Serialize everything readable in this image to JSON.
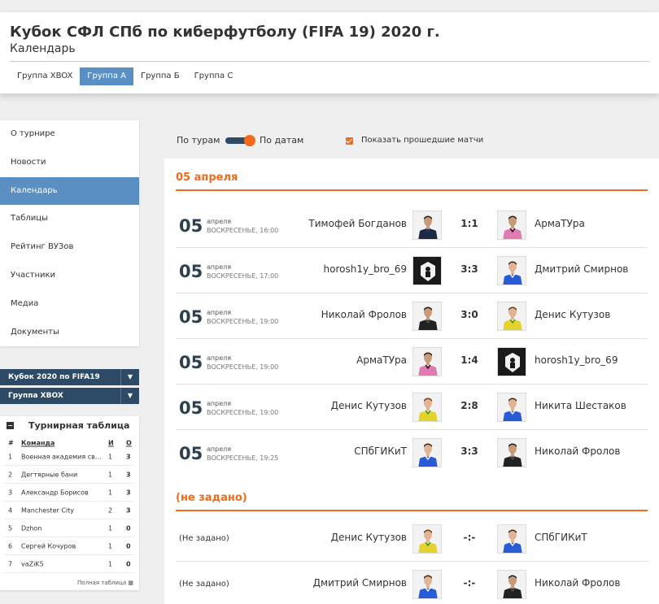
{
  "header": {
    "title": "Кубок СФЛ СПб по киберфутболу (FIFA 19) 2020 г.",
    "subtitle": "Календарь",
    "tabs": [
      {
        "label": "Группа XBOX",
        "active": false
      },
      {
        "label": "Группа А",
        "active": true
      },
      {
        "label": "Группа Б",
        "active": false
      },
      {
        "label": "Группа С",
        "active": false
      }
    ]
  },
  "menu": {
    "items": [
      {
        "label": "О турнире",
        "active": false
      },
      {
        "label": "Новости",
        "active": false
      },
      {
        "label": "Календарь",
        "active": true
      },
      {
        "label": "Таблицы",
        "active": false
      },
      {
        "label": "Рейтинг ВУЗов",
        "active": false
      },
      {
        "label": "Участники",
        "active": false
      },
      {
        "label": "Медиа",
        "active": false
      },
      {
        "label": "Документы",
        "active": false
      }
    ]
  },
  "selects": {
    "tournament": "Кубок 2020 по FIFA19",
    "group": "Группа XBOX",
    "arrow_icon": "caret-down-icon"
  },
  "standings": {
    "title": "Турнирная таблица",
    "headers": {
      "num": "#",
      "team": "Команда",
      "played": "И",
      "points": "О"
    },
    "rows": [
      {
        "num": "1",
        "team": "Военная академия связи",
        "played": "1",
        "points": "3"
      },
      {
        "num": "2",
        "team": "Дегтярные бани",
        "played": "1",
        "points": "3"
      },
      {
        "num": "3",
        "team": "Александр Борисов",
        "played": "1",
        "points": "3"
      },
      {
        "num": "4",
        "team": "Manchester City",
        "played": "2",
        "points": "3"
      },
      {
        "num": "5",
        "team": "Dzhon",
        "played": "1",
        "points": "0"
      },
      {
        "num": "6",
        "team": "Сергей Кочуров",
        "played": "1",
        "points": "0"
      },
      {
        "num": "7",
        "team": "vaZiK5",
        "played": "1",
        "points": "0"
      }
    ],
    "full_table_label": "Полная таблица"
  },
  "controls": {
    "by_rounds": "По турам",
    "by_dates": "По датам",
    "show_past": "Показать прошедшие матчи",
    "show_past_checked": true
  },
  "sections": [
    {
      "date": "05 апреля",
      "matches": [
        {
          "day": "05",
          "month": "апреля",
          "time": "ВОСКРЕСЕНЬЕ, 16:00",
          "home": "Тимофей Богданов",
          "home_kit": "dark",
          "score": "1:1",
          "away": "АрмаТУра",
          "away_kit": "pink"
        },
        {
          "day": "05",
          "month": "апреля",
          "time": "ВОСКРЕСЕНЬЕ, 17:00",
          "home": "horosh1y_bro_69",
          "home_kit": "logo",
          "score": "3:3",
          "away": "Дмитрий Смирнов",
          "away_kit": "blue"
        },
        {
          "day": "05",
          "month": "апреля",
          "time": "ВОСКРЕСЕНЬЕ, 19:00",
          "home": "Николай Фролов",
          "home_kit": "black",
          "score": "3:0",
          "away": "Денис Кутузов",
          "away_kit": "yellow"
        },
        {
          "day": "05",
          "month": "апреля",
          "time": "ВОСКРЕСЕНЬЕ, 19:00",
          "home": "АрмаТУра",
          "home_kit": "pink",
          "score": "1:4",
          "away": "horosh1y_bro_69",
          "away_kit": "logo"
        },
        {
          "day": "05",
          "month": "апреля",
          "time": "ВОСКРЕСЕНЬЕ, 19:00",
          "home": "Денис Кутузов",
          "home_kit": "yellow",
          "score": "2:8",
          "away": "Никита Шестаков",
          "away_kit": "blue"
        },
        {
          "day": "05",
          "month": "апреля",
          "time": "ВОСКРЕСЕНЬЕ, 19:25",
          "home": "СПбГИКиТ",
          "home_kit": "blue",
          "score": "3:3",
          "away": "Николай Фролов",
          "away_kit": "black"
        }
      ]
    },
    {
      "date": "(не задано)",
      "matches": [
        {
          "unset": "(Не задано)",
          "home": "Денис Кутузов",
          "home_kit": "yellow",
          "score": "-:-",
          "away": "СПбГИКиТ",
          "away_kit": "blue"
        },
        {
          "unset": "(Не задано)",
          "home": "Дмитрий Смирнов",
          "home_kit": "blue",
          "score": "-:-",
          "away": "Николай Фролов",
          "away_kit": "black"
        }
      ]
    }
  ],
  "colors": {
    "accent": "#f26a1b",
    "nav_blue": "#5a8fc4",
    "dark_navy": "#2d4a66"
  }
}
